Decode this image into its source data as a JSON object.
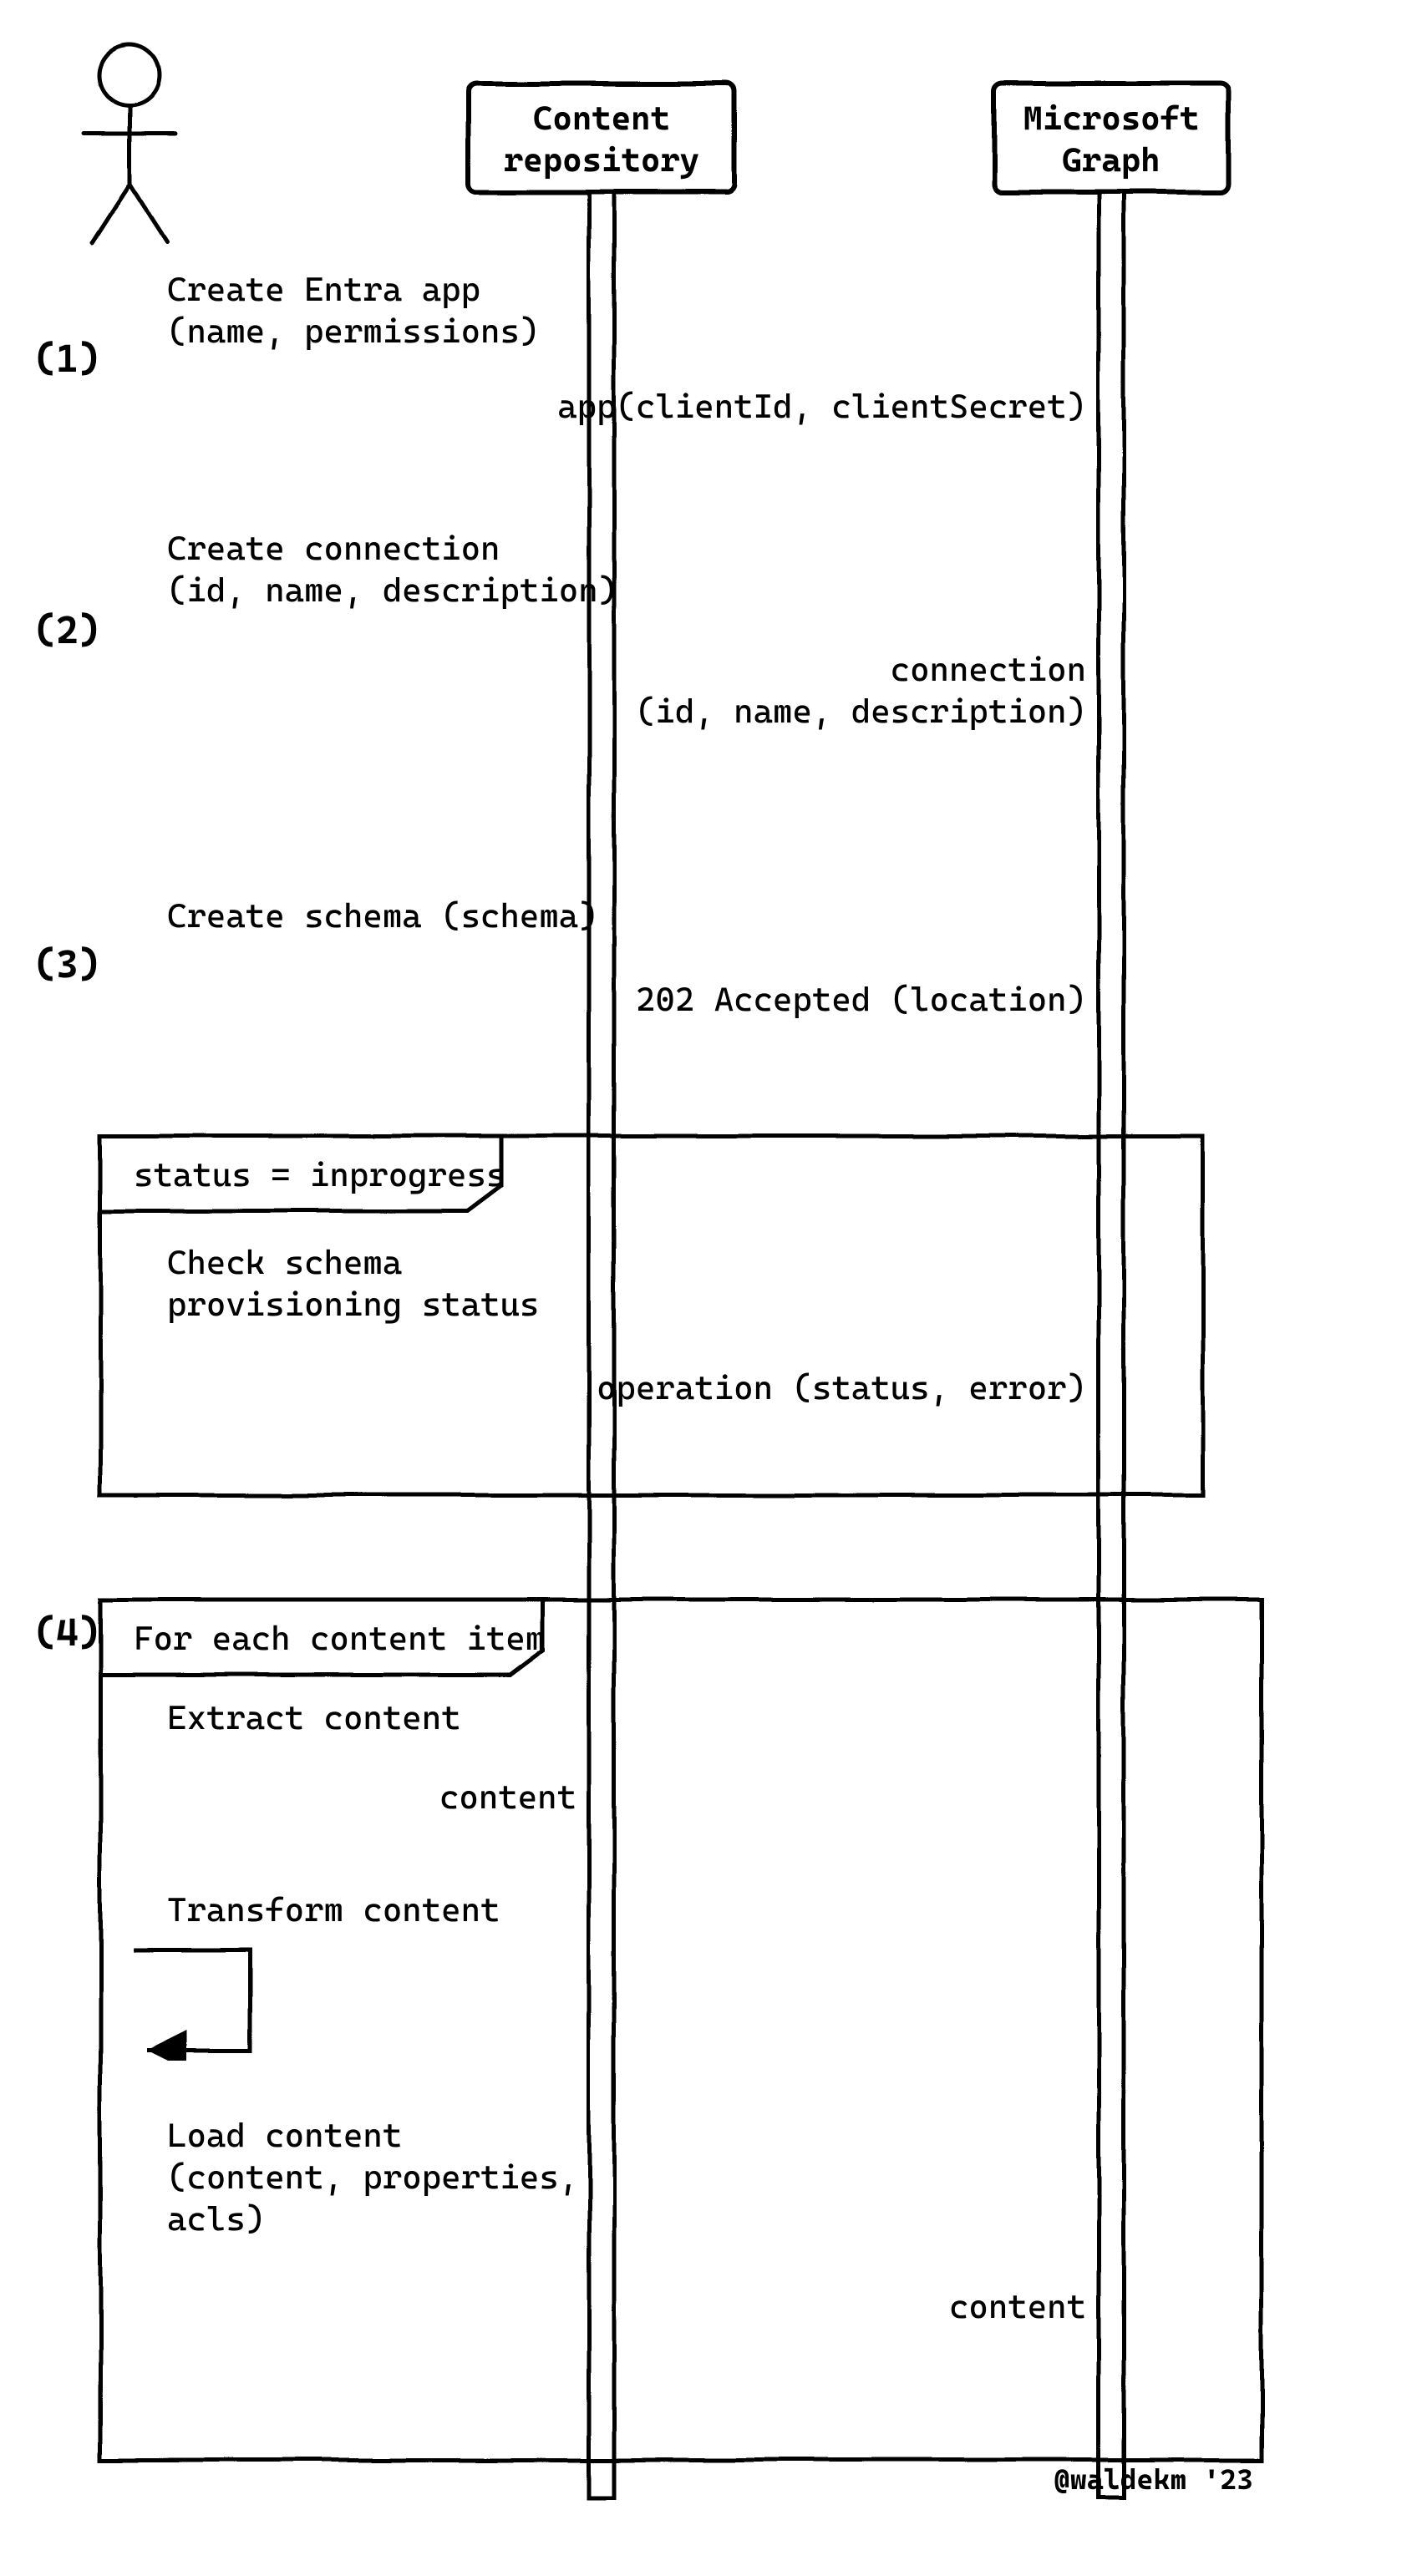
{
  "participants": {
    "actor": "",
    "content_repo_line1": "Content",
    "content_repo_line2": "repository",
    "ms_graph_line1": "Microsoft",
    "ms_graph_line2": "Graph"
  },
  "steps": {
    "s1": "(1)",
    "s2": "(2)",
    "s3": "(3)",
    "s4": "(4)"
  },
  "messages": {
    "m1a": "Create Entra app",
    "m1b": "(name, permissions)",
    "r1": "app(clientId, clientSecret)",
    "m2a": "Create connection",
    "m2b": "(id, name, description)",
    "r2a": "connection",
    "r2b": "(id, name, description)",
    "m3": "Create schema (schema)",
    "r3": "202 Accepted (location)",
    "loop1_title": "status = inprogress",
    "m4a": "Check schema",
    "m4b": "provisioning status",
    "r4": "operation (status, error)",
    "loop2_title": "For each content item",
    "m5": "Extract content",
    "r5": "content",
    "m6": "Transform content",
    "m7a": "Load content",
    "m7b": "(content, properties,",
    "m7c": "acls)",
    "r7": "content"
  },
  "credit": "@waldekm '23"
}
